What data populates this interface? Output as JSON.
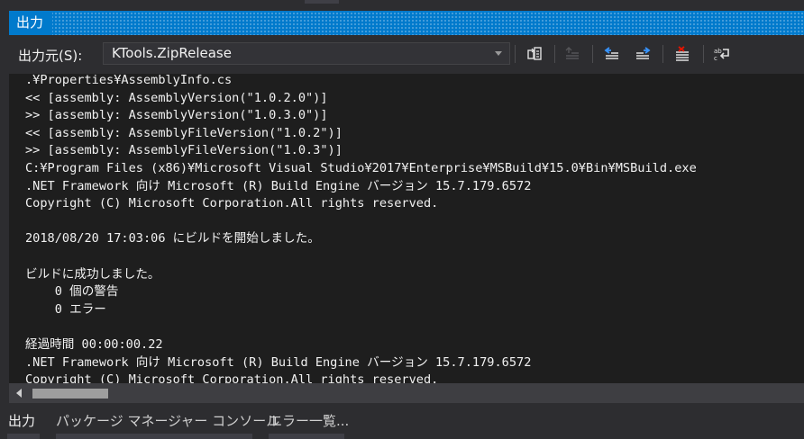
{
  "panel": {
    "title": "出力",
    "source_label": "出力元(S):",
    "source_value": "KTools.ZipRelease"
  },
  "toolbar_icons": [
    "find-message-in-code-icon",
    "previous-message-icon",
    "go-to-previous-icon",
    "go-to-next-icon",
    "clear-all-icon",
    "word-wrap-icon"
  ],
  "output_lines": [
    ".¥Properties¥AssemblyInfo.cs",
    "<< [assembly: AssemblyVersion(\"1.0.2.0\")]",
    ">> [assembly: AssemblyVersion(\"1.0.3.0\")]",
    "<< [assembly: AssemblyFileVersion(\"1.0.2\")]",
    ">> [assembly: AssemblyFileVersion(\"1.0.3\")]",
    "C:¥Program Files (x86)¥Microsoft Visual Studio¥2017¥Enterprise¥MSBuild¥15.0¥Bin¥MSBuild.exe",
    ".NET Framework 向け Microsoft (R) Build Engine バージョン 15.7.179.6572",
    "Copyright (C) Microsoft Corporation.All rights reserved.",
    "",
    "2018/08/20 17:03:06 にビルドを開始しました。",
    "",
    "ビルドに成功しました。",
    "    0 個の警告",
    "    0 エラー",
    "",
    "経過時間 00:00:00.22",
    ".NET Framework 向け Microsoft (R) Build Engine バージョン 15.7.179.6572",
    "Copyright (C) Microsoft Corporation.All rights reserved."
  ],
  "bottom_tabs": [
    "出力",
    "パッケージ マネージャー コンソール",
    "エラー一覧..."
  ],
  "colors": {
    "accent": "#007acc",
    "background": "#2d2d30",
    "editor": "#1e1e1e",
    "text": "#f1f1f1"
  }
}
